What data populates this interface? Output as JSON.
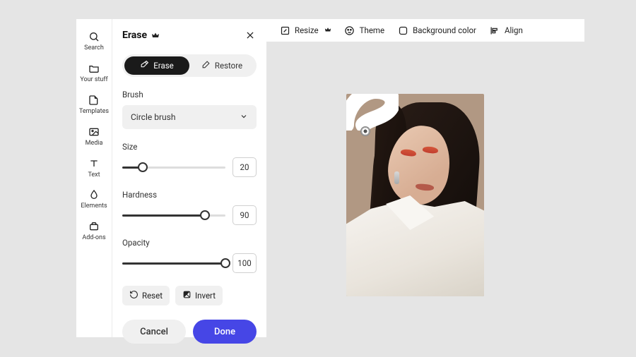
{
  "sidebar": {
    "items": [
      {
        "label": "Search",
        "icon": "search-icon"
      },
      {
        "label": "Your stuff",
        "icon": "folder-icon"
      },
      {
        "label": "Templates",
        "icon": "template-icon"
      },
      {
        "label": "Media",
        "icon": "media-icon"
      },
      {
        "label": "Text",
        "icon": "text-icon"
      },
      {
        "label": "Elements",
        "icon": "elements-icon"
      },
      {
        "label": "Add-ons",
        "icon": "addons-icon"
      }
    ]
  },
  "panel": {
    "title": "Erase",
    "segmented": {
      "erase": "Erase",
      "restore": "Restore",
      "active": "erase"
    },
    "brush": {
      "label": "Brush",
      "value": "Circle brush"
    },
    "size": {
      "label": "Size",
      "value": 20,
      "min": 0,
      "max": 100
    },
    "hardness": {
      "label": "Hardness",
      "value": 90,
      "min": 0,
      "max": 100
    },
    "opacity": {
      "label": "Opacity",
      "value": 100,
      "min": 0,
      "max": 100
    },
    "reset": "Reset",
    "invert": "Invert",
    "cancel": "Cancel",
    "done": "Done"
  },
  "toolbar": {
    "resize": "Resize",
    "theme": "Theme",
    "background_color": "Background color",
    "align": "Align"
  }
}
